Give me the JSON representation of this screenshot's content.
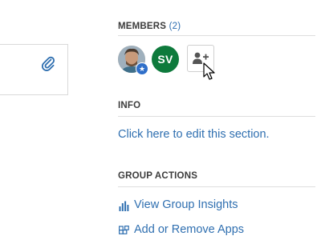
{
  "members": {
    "heading": "MEMBERS",
    "count": "(2)",
    "initials": "SV"
  },
  "info": {
    "heading": "INFO",
    "edit_link": "Click here to edit this section."
  },
  "group_actions": {
    "heading": "GROUP ACTIONS",
    "items": [
      {
        "label": "View Group Insights",
        "icon": "bar-chart-icon"
      },
      {
        "label": "Add or Remove Apps",
        "icon": "apps-icon"
      }
    ]
  },
  "colors": {
    "link": "#2f6fb0",
    "avatar_green": "#0e7a3c",
    "owner_badge": "#2f6fc9"
  }
}
